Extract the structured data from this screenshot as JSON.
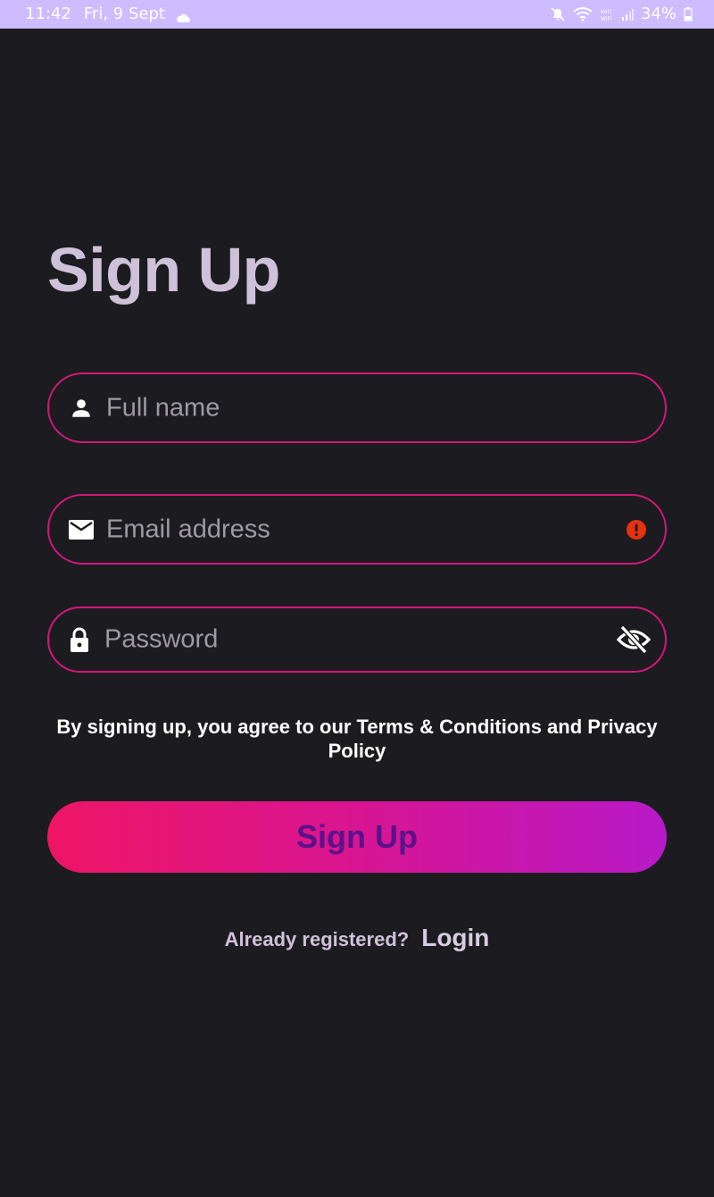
{
  "status_bar": {
    "time": "11:42",
    "date": "Fri, 9 Sept",
    "weather_icon": "cloud-icon",
    "battery": "34%",
    "icons": [
      "mute-icon",
      "wifi-icon",
      "volte-icon",
      "signal-icon",
      "battery-icon"
    ]
  },
  "page": {
    "title": "Sign Up"
  },
  "form": {
    "full_name": {
      "placeholder": "Full name",
      "icon": "person-icon"
    },
    "email": {
      "placeholder": "Email address",
      "icon": "mail-icon",
      "error_icon": "error-icon"
    },
    "password": {
      "placeholder": "Password",
      "icon": "lock-icon",
      "toggle_icon": "visibility-off-icon"
    }
  },
  "terms_text": "By signing up, you agree to our Terms & Conditions and Privacy Policy",
  "submit_label": "Sign Up",
  "footer": {
    "question": "Already registered?",
    "login_label": "Login"
  },
  "colors": {
    "background": "#1c1b20",
    "status_bar": "#cdbcff",
    "field_border": "#d4177a",
    "title": "#cec2d8",
    "button_start": "#ee1565",
    "button_end": "#b81ac8",
    "button_text": "#5a128a",
    "error": "#e53210"
  }
}
